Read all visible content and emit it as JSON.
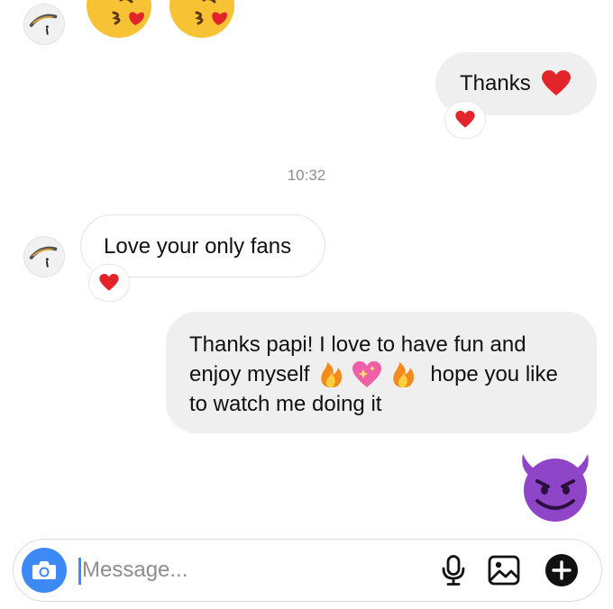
{
  "conversation": {
    "messages": [
      {
        "sender": "them",
        "type": "emoji",
        "content": "kissing-face-with-heart x2"
      },
      {
        "sender": "me",
        "type": "text",
        "text": "Thanks",
        "emoji": "red-heart",
        "reaction": "red-heart"
      },
      {
        "sender": "them",
        "type": "text",
        "text": "Love your only fans",
        "reaction": "red-heart"
      },
      {
        "sender": "me",
        "type": "text",
        "lines": [
          "Thanks papi! I love to have fun and",
          "enjoy myself",
          "hope you like",
          "to watch me doing it"
        ],
        "emojis": [
          "fire",
          "sparkling-heart",
          "fire"
        ]
      },
      {
        "sender": "me",
        "type": "emoji",
        "content": "smiling-devil"
      }
    ],
    "msg_thanks": "Thanks",
    "msg_love": "Love your only fans",
    "msg_long_line1": "Thanks papi! I love to have fun and",
    "msg_long_line2a": "enjoy myself",
    "msg_long_line2b": "hope you like",
    "msg_long_line3": "to watch me doing it",
    "timestamp": "10:32"
  },
  "composer": {
    "placeholder": "Message...",
    "value": ""
  },
  "icons": {
    "avatar": "skydiver-avatar-icon",
    "camera": "camera-icon",
    "mic": "microphone-icon",
    "gallery": "gallery-icon",
    "add": "plus-circle-icon",
    "reaction": "red-heart-icon"
  },
  "colors": {
    "accent": "#3d8af7",
    "heart": "#e3242b",
    "outgoing_bubble": "#efefef",
    "incoming_border": "#e3e3e3",
    "timestamp": "#8e8e8e"
  }
}
